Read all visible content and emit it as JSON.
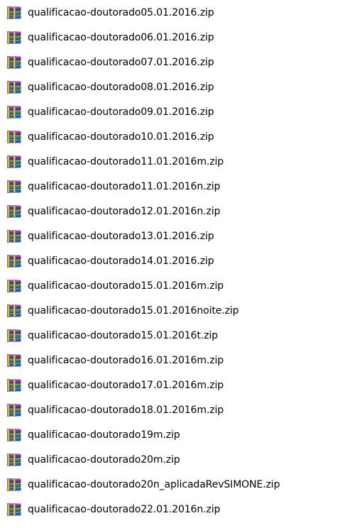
{
  "icon_type": "winrar-archive-icon",
  "files": [
    {
      "name": "qualificacao-doutorado05.01.2016.zip"
    },
    {
      "name": "qualificacao-doutorado06.01.2016.zip"
    },
    {
      "name": "qualificacao-doutorado07.01.2016.zip"
    },
    {
      "name": "qualificacao-doutorado08.01.2016.zip"
    },
    {
      "name": "qualificacao-doutorado09.01.2016.zip"
    },
    {
      "name": "qualificacao-doutorado10.01.2016.zip"
    },
    {
      "name": "qualificacao-doutorado11.01.2016m.zip"
    },
    {
      "name": "qualificacao-doutorado11.01.2016n.zip"
    },
    {
      "name": "qualificacao-doutorado12.01.2016n.zip"
    },
    {
      "name": "qualificacao-doutorado13.01.2016.zip"
    },
    {
      "name": "qualificacao-doutorado14.01.2016.zip"
    },
    {
      "name": "qualificacao-doutorado15.01.2016m.zip"
    },
    {
      "name": "qualificacao-doutorado15.01.2016noite.zip"
    },
    {
      "name": "qualificacao-doutorado15.01.2016t.zip"
    },
    {
      "name": "qualificacao-doutorado16.01.2016m.zip"
    },
    {
      "name": "qualificacao-doutorado17.01.2016m.zip"
    },
    {
      "name": "qualificacao-doutorado18.01.2016m.zip"
    },
    {
      "name": "qualificacao-doutorado19m.zip"
    },
    {
      "name": "qualificacao-doutorado20m.zip"
    },
    {
      "name": "qualificacao-doutorado20n_aplicadaRevSIMONE.zip"
    },
    {
      "name": "qualificacao-doutorado22.01.2016n.zip"
    }
  ]
}
